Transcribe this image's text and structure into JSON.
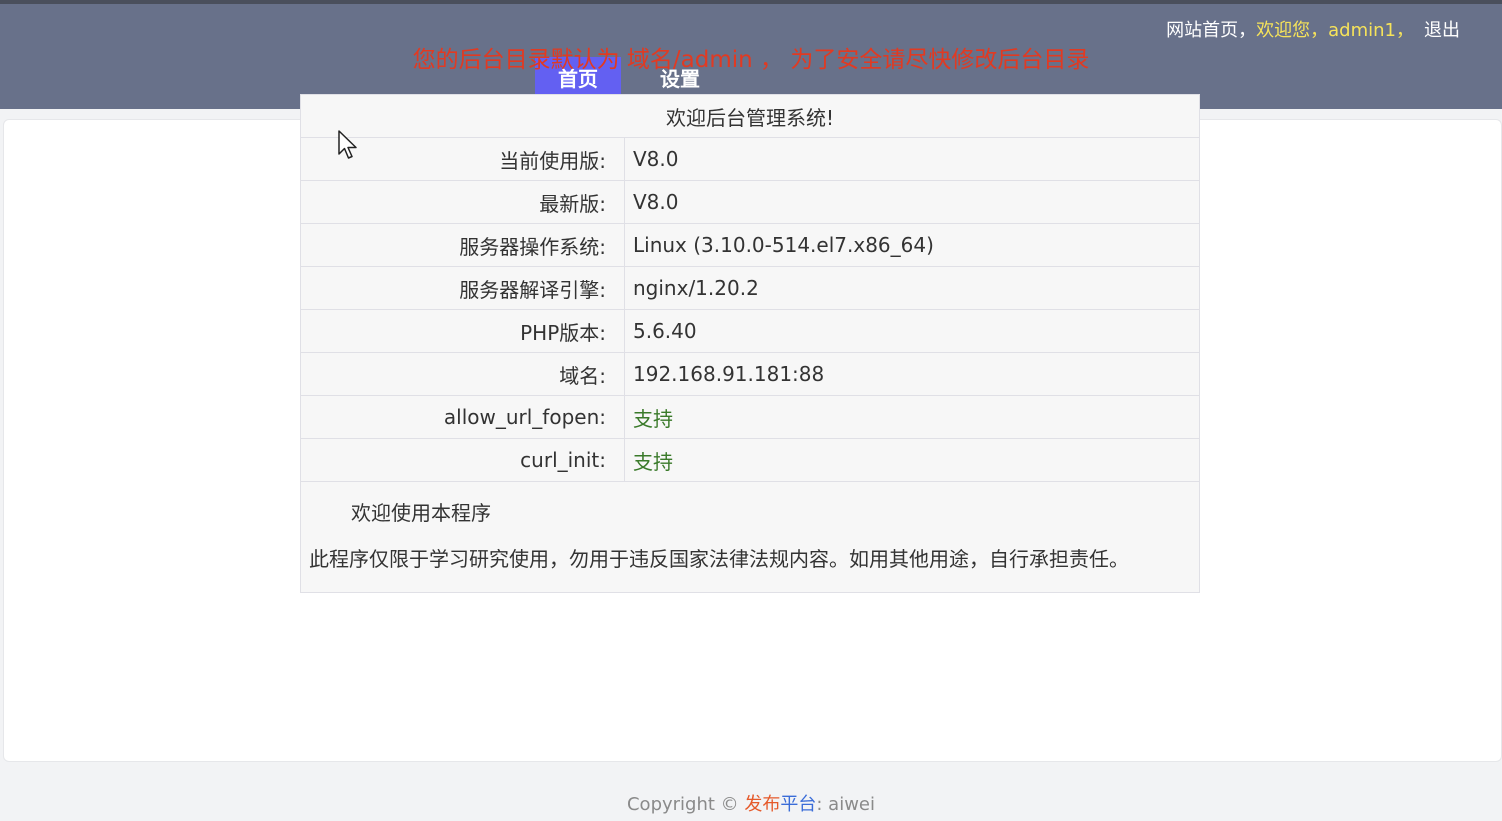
{
  "header": {
    "home_link": "网站首页，",
    "welcome": "欢迎您，admin1，",
    "logout": "退出",
    "nav": [
      {
        "label": "首页",
        "active": true
      },
      {
        "label": "设置",
        "active": false
      }
    ]
  },
  "notice": "您的后台目录默认为 域名/admin ， 为了安全请尽快修改后台目录",
  "info": {
    "title": "欢迎后台管理系统!",
    "rows": [
      {
        "label": "当前使用版:",
        "value": "V8.0"
      },
      {
        "label": "最新版:",
        "value": "V8.0"
      },
      {
        "label": "服务器操作系统:",
        "value": "Linux (3.10.0-514.el7.x86_64)"
      },
      {
        "label": "服务器解译引擎:",
        "value": "nginx/1.20.2"
      },
      {
        "label": "PHP版本:",
        "value": "5.6.40"
      },
      {
        "label": "域名:",
        "value": "192.168.91.181:88"
      },
      {
        "label": "allow_url_fopen:",
        "value": "支持"
      },
      {
        "label": "curl_init:",
        "value": "支持"
      }
    ],
    "footer_line1": "欢迎使用本程序",
    "footer_line2": "此程序仅限于学习研究使用，勿用于违反国家法律法规内容。如用其他用途，自行承担责任。"
  },
  "copyright": {
    "prefix": "Copyright © ",
    "part1": "发布",
    "part2": "平台",
    "suffix": ": aiwei"
  },
  "colors": {
    "header_bg": "#68718a",
    "nav_active": "#6360f2",
    "notice": "#e13a22",
    "welcome": "#f6e35a",
    "supported": "#3a7a2a"
  },
  "icons": {
    "cursor": "mouse-pointer-icon"
  }
}
